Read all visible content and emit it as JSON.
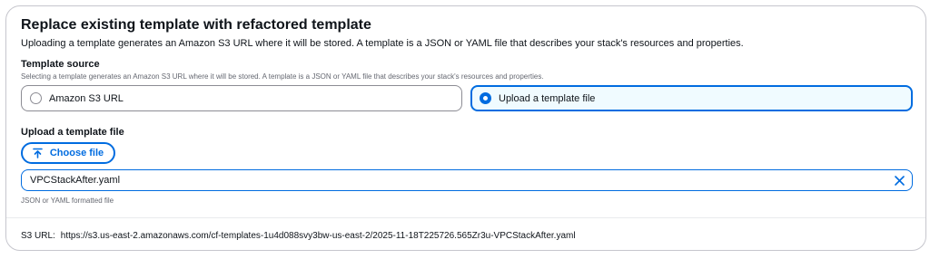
{
  "section": {
    "title": "Replace existing template with refactored template",
    "description": "Uploading a template generates an Amazon S3 URL where it will be stored. A template is a JSON or YAML file that describes your stack's resources and properties."
  },
  "template_source": {
    "label": "Template source",
    "description": "Selecting a template generates an Amazon S3 URL where it will be stored. A template is a JSON or YAML file that describes your stack's resources and properties.",
    "options": [
      {
        "label": "Amazon S3 URL",
        "selected": false
      },
      {
        "label": "Upload a template file",
        "selected": true
      }
    ]
  },
  "upload": {
    "label": "Upload a template file",
    "choose_button_label": "Choose file",
    "choose_icon": "upload-arrow-icon",
    "file_name": "VPCStackAfter.yaml",
    "clear_icon": "close-icon",
    "hint": "JSON or YAML formatted file"
  },
  "s3_url": {
    "label": "S3 URL:",
    "value": "https://s3.us-east-2.amazonaws.com/cf-templates-1u4d088svy3bw-us-east-2/2025-11-18T225726.565Zr3u-VPCStackAfter.yaml"
  },
  "colors": {
    "accent": "#006ce0",
    "selected_bg": "#f0fbff",
    "border": "#c6c6cd",
    "muted_text": "#656871"
  }
}
